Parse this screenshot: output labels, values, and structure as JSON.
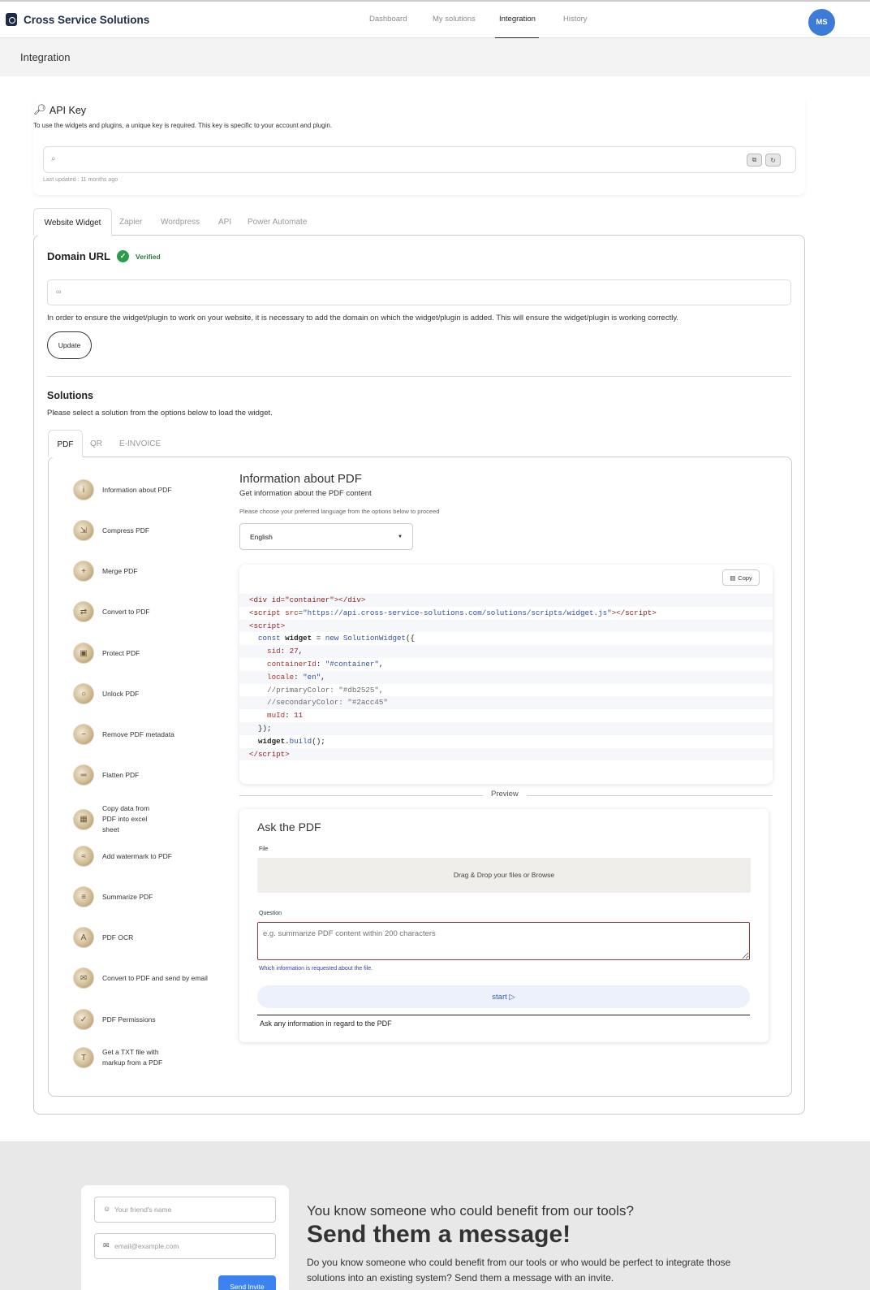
{
  "app": {
    "name": "Cross Service Solutions",
    "avatar_initials": "MS"
  },
  "nav": {
    "tabs": [
      "Dashboard",
      "My solutions",
      "Integration",
      "History"
    ],
    "active": "Integration"
  },
  "page_title": "Integration",
  "api_key": {
    "title": "API Key",
    "description": "To use the widgets and plugins, a unique key is required. This key is specific to your account and plugin.",
    "value": "",
    "last_updated": "Last updated : 11 months ago"
  },
  "integration_tabs": [
    "Website Widget",
    "Zapier",
    "Wordpress",
    "API",
    "Power Automate"
  ],
  "domain": {
    "title": "Domain URL",
    "status": "Verified",
    "value": "",
    "help": "In order to ensure the widget/plugin to work on your website, it is necessary to add the domain on which the widget/plugin is added. This will ensure the widget/plugin is working correctly.",
    "update_label": "Update"
  },
  "solutions": {
    "title": "Solutions",
    "description": "Please select a solution from the options below to load the widget.",
    "tabs": [
      "PDF",
      "QR",
      "E-INVOICE"
    ],
    "items": [
      "Information about PDF",
      "Compress PDF",
      "Merge PDF",
      "Convert to PDF",
      "Protect PDF",
      "Unlock PDF",
      "Remove PDF metadata",
      "Flatten PDF",
      "Copy data from PDF into excel sheet",
      "Add watermark to PDF",
      "Summarize PDF",
      "PDF OCR",
      "Convert to PDF and send by email",
      "PDF Permissions",
      "Get a TXT file with markup from a PDF"
    ]
  },
  "detail": {
    "title": "Information about PDF",
    "subtitle": "Get information about the PDF content",
    "language_hint": "Please choose your preferred language from the options below to proceed",
    "language": "English",
    "copy_label": "Copy",
    "code": {
      "line1": "<div id=\"container\"></div>",
      "line2_src": "\"https://api.cross-service-solutions.com/solutions/scripts/widget.js\"",
      "sid": "27",
      "container": "\"#container\"",
      "locale": "\"en\"",
      "primary": "//primaryColor: \"#db2525\",",
      "secondary": "//secondaryColor: \"#2acc45\"",
      "muid": "11"
    },
    "preview_label": "Preview"
  },
  "widget_preview": {
    "title": "Ask the PDF",
    "file_label": "File",
    "dropzone": "Drag & Drop your files or Browse",
    "question_label": "Question",
    "question_placeholder": "e.g. summarize PDF content within 200 characters",
    "question_help": "Which information is requested about the file.",
    "start_label": "start",
    "footer_text": "Ask any information in regard to the PDF"
  },
  "invite": {
    "name_placeholder": "Your friend's name",
    "email_placeholder": "email@example.com",
    "send_label": "Send Invite",
    "subtitle": "You know someone who could benefit from our tools?",
    "title": "Send them a message!",
    "text": "Do you know someone who could benefit from our tools or who would be perfect to integrate those solutions into an existing system? Send them a message with an invite."
  },
  "colors": {
    "accent": "#3d7bd9",
    "verified": "#2a9d4b",
    "brand": "#1e2b45"
  }
}
